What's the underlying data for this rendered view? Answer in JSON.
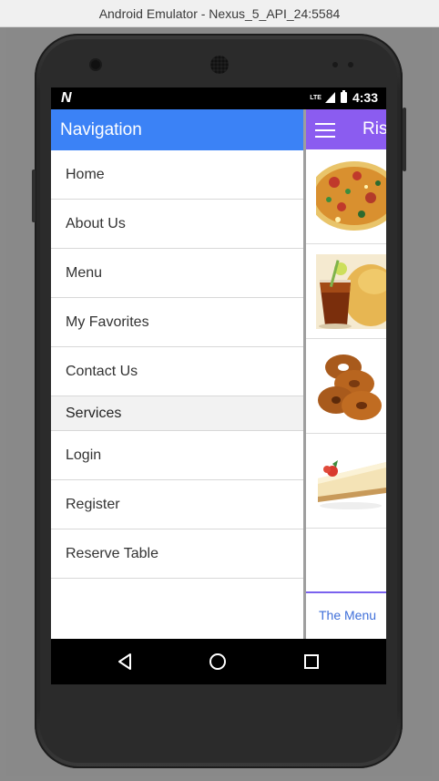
{
  "window": {
    "title": "Android Emulator - Nexus_5_API_24:5584"
  },
  "status_bar": {
    "left_logo": "N",
    "network": "LTE",
    "time": "4:33"
  },
  "app": {
    "title": "Ris"
  },
  "drawer": {
    "header": "Navigation",
    "items_top": [
      {
        "label": "Home"
      },
      {
        "label": "About Us"
      },
      {
        "label": "Menu"
      },
      {
        "label": "My Favorites"
      },
      {
        "label": "Contact Us"
      }
    ],
    "section": "Services",
    "items_bottom": [
      {
        "label": "Login"
      },
      {
        "label": "Register"
      },
      {
        "label": "Reserve Table"
      }
    ]
  },
  "food_items": [
    {
      "icon": "pizza-image"
    },
    {
      "icon": "drink-chips-image"
    },
    {
      "icon": "donuts-image"
    },
    {
      "icon": "cheesecake-image"
    }
  ],
  "bottom_tab": {
    "label": "The Menu"
  },
  "colors": {
    "drawer_header": "#3b82f6",
    "app_toolbar": "#8b5cf0",
    "tab_text": "#3f6fd9"
  }
}
